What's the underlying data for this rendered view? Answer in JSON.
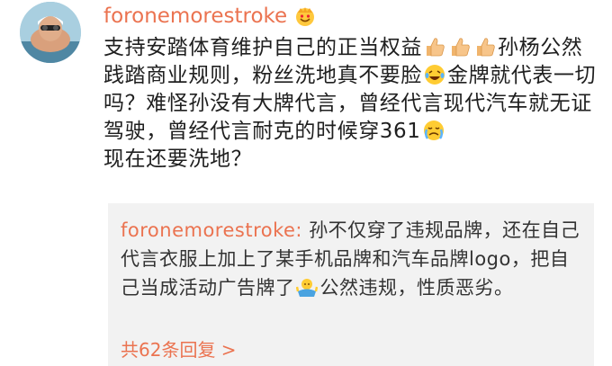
{
  "comment": {
    "username": "foronemorestroke",
    "badge_icon": "crown-smile-icon",
    "text_1": "支持安踏体育维护自己的正当权益",
    "text_2": "孙杨公然践踏商业规则，粉丝洗地真不要脸",
    "text_3": "金牌就代表一切吗？难怪孙没有大牌代言，曾经代言现代汽车就无证驾驶，曾经代言耐克的时候穿361",
    "text_4": "现在还要洗地？",
    "emojis": [
      "thumbs-up-icon",
      "thumbs-up-icon",
      "thumbs-up-icon",
      "laughing-tears-icon",
      "crying-face-icon"
    ]
  },
  "reply": {
    "username": "foronemorestroke:",
    "text_1": "孙不仅穿了违规品牌，还在自己代言衣服上加上了某手机品牌和汽车品牌logo，把自己当成活动广告牌了",
    "text_2": "公然违规，性质恶劣。",
    "emoji": "shrug-icon",
    "count_label": "共62条回复 >"
  },
  "colors": {
    "accent": "#eb7350",
    "text": "#1f1f1f",
    "reply_bg": "#f2f2f2"
  }
}
